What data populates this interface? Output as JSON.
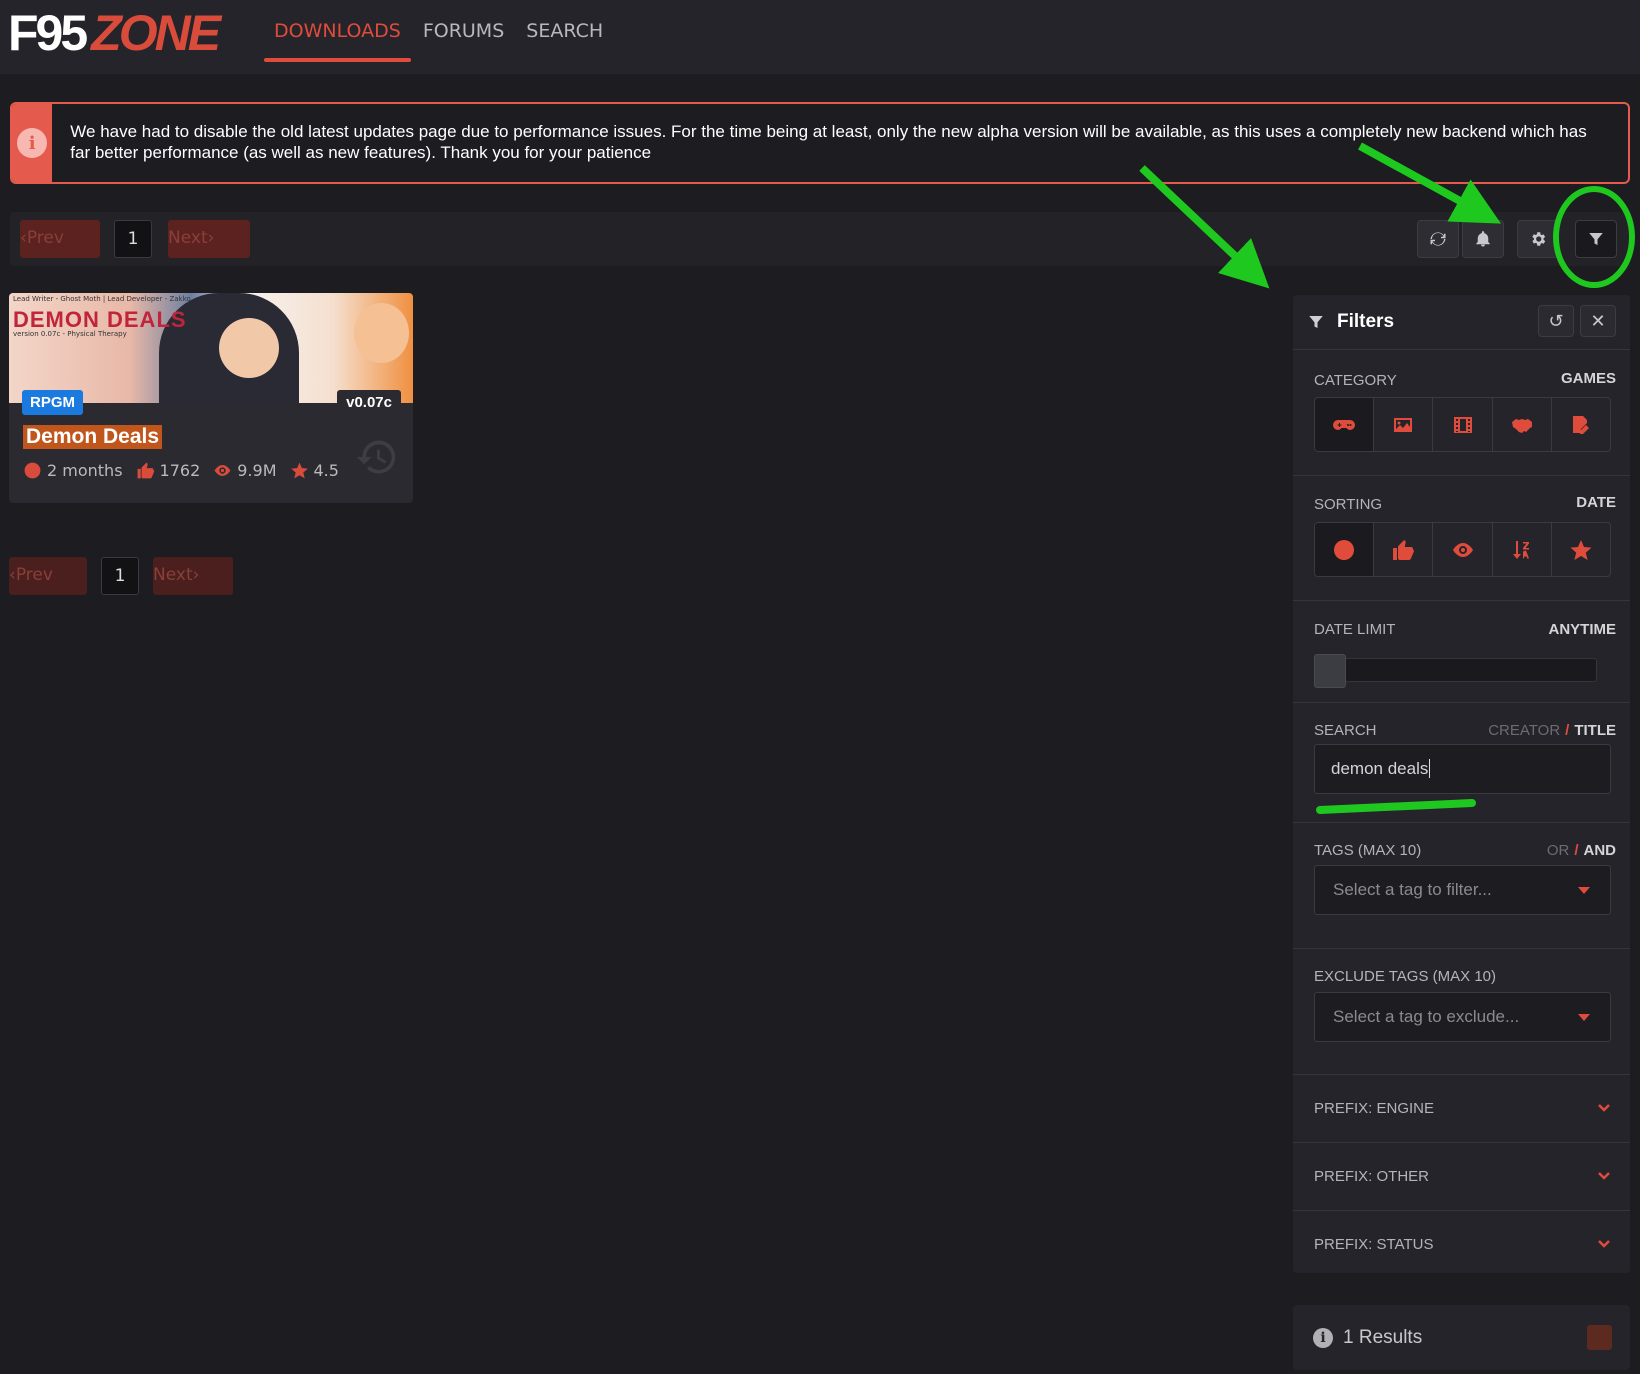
{
  "header": {
    "logo_left": "F95",
    "logo_right": "ZONE",
    "nav": [
      {
        "label": "DOWNLOADS",
        "active": true
      },
      {
        "label": "FORUMS",
        "active": false
      },
      {
        "label": "SEARCH",
        "active": false
      }
    ]
  },
  "notice": {
    "icon": "info-icon",
    "text": "We have had to disable the old latest updates page due to performance issues. For the time being at least, only the new alpha version will be available, as this uses a completely new backend which has far better performance (as well as new features). Thank you for your patience"
  },
  "pagination_top": {
    "prev": "Prev",
    "page": "1",
    "next": "Next"
  },
  "pagination_bottom": {
    "prev": "Prev",
    "page": "1",
    "next": "Next"
  },
  "toolbar_icons": [
    "refresh-icon",
    "bell-icon",
    "gear-icon",
    "filter-icon"
  ],
  "game_card": {
    "image_title": "DEMON DEALS",
    "image_credits": "Lead Writer - Ghost Moth | Lead Developer - Zakko",
    "image_version": "version 0.07c - Physical Therapy",
    "engine": "RPGM",
    "version": "v0.07c",
    "title": "Demon Deals",
    "updated": "2 months",
    "likes": "1762",
    "views": "9.9M",
    "rating": "4.5"
  },
  "filters": {
    "title": "Filters",
    "category": {
      "label": "CATEGORY",
      "value": "GAMES",
      "icons": [
        "gamepad-icon",
        "image-icon",
        "film-icon",
        "handshake-icon",
        "file-signature-icon"
      ],
      "selected": 0
    },
    "sorting": {
      "label": "SORTING",
      "value": "DATE",
      "icons": [
        "clock-icon",
        "thumbs-up-icon",
        "eye-icon",
        "sort-alpha-icon",
        "star-icon"
      ],
      "selected": 0
    },
    "date_limit": {
      "label": "DATE LIMIT",
      "value": "ANYTIME",
      "level": 0
    },
    "search": {
      "label": "SEARCH",
      "opt1": "CREATOR",
      "sep": "/",
      "opt2": "TITLE",
      "value": "demon deals"
    },
    "tags": {
      "label": "TAGS (MAX 10)",
      "opt1": "OR",
      "sep": "/",
      "opt2": "AND",
      "placeholder": "Select a tag to filter..."
    },
    "exclude": {
      "label": "EXCLUDE TAGS (MAX 10)",
      "placeholder": "Select a tag to exclude..."
    },
    "prefixes": [
      "PREFIX: ENGINE",
      "PREFIX: OTHER",
      "PREFIX: STATUS"
    ]
  },
  "results": {
    "text": "1 Results"
  },
  "colors": {
    "accent": "#e04c3c",
    "annotation": "#1ec81e",
    "engine_badge": "#1a7ae0"
  }
}
